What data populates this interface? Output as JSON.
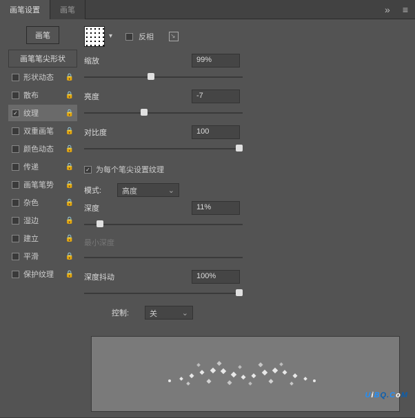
{
  "tabs": {
    "settings": "画笔设置",
    "brush": "画笔",
    "chevrons": "»",
    "menu": "≡"
  },
  "left": {
    "brush_button": "画笔",
    "header": "画笔笔尖形状",
    "items": [
      {
        "label": "形状动态",
        "checked": false
      },
      {
        "label": "散布",
        "checked": false
      },
      {
        "label": "纹理",
        "checked": true
      },
      {
        "label": "双重画笔",
        "checked": false
      },
      {
        "label": "颜色动态",
        "checked": false
      },
      {
        "label": "传递",
        "checked": false
      },
      {
        "label": "画笔笔势",
        "checked": false
      },
      {
        "label": "杂色",
        "checked": false
      },
      {
        "label": "湿边",
        "checked": false
      },
      {
        "label": "建立",
        "checked": false
      },
      {
        "label": "平滑",
        "checked": false
      },
      {
        "label": "保护纹理",
        "checked": false
      }
    ]
  },
  "right": {
    "invert": {
      "label": "反相",
      "checked": false
    },
    "scale": {
      "label": "缩放",
      "value": "99%",
      "pos": 42
    },
    "brightness": {
      "label": "亮度",
      "value": "-7",
      "pos": 38
    },
    "contrast": {
      "label": "对比度",
      "value": "100",
      "pos": 98
    },
    "per_tip": {
      "label": "为每个笔尖设置纹理",
      "checked": true
    },
    "mode": {
      "label": "模式:",
      "value": "高度"
    },
    "depth": {
      "label": "深度",
      "value": "11%",
      "pos": 10
    },
    "min_depth": {
      "label": "最小深度"
    },
    "depth_jitter": {
      "label": "深度抖动",
      "value": "100%",
      "pos": 98
    },
    "control": {
      "label": "控制:",
      "value": "关"
    }
  },
  "watermark": {
    "u": "U",
    "i": "i",
    "b": "B",
    "q": "Q.",
    "c": "C",
    "o": "o",
    "m": "M"
  }
}
